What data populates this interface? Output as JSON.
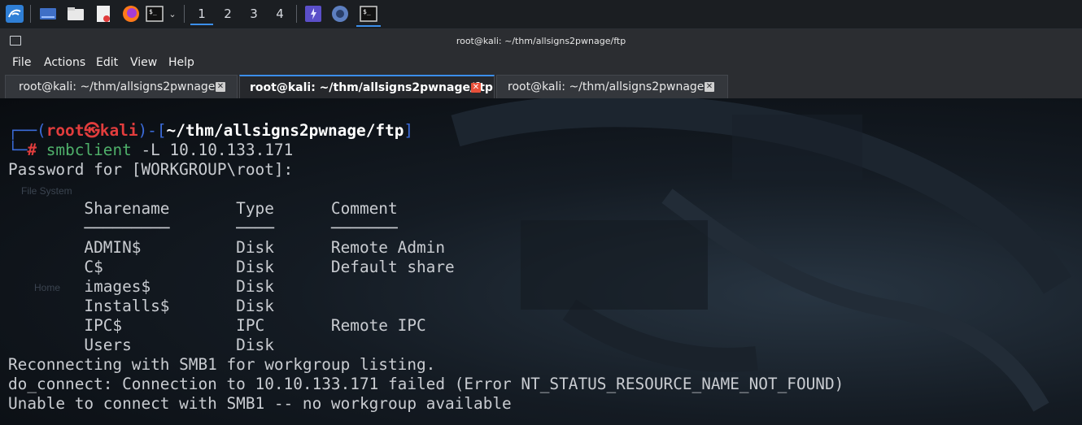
{
  "taskbar": {
    "workspaces": [
      "1",
      "2",
      "3",
      "4"
    ],
    "active_workspace": "1"
  },
  "window": {
    "title": "root@kali: ~/thm/allsigns2pwnage/ftp",
    "menu": [
      "File",
      "Actions",
      "Edit",
      "View",
      "Help"
    ],
    "tabs": [
      {
        "label": "root@kali: ~/thm/allsigns2pwnage",
        "active": false
      },
      {
        "label": "root@kali: ~/thm/allsigns2pwnage/ftp",
        "active": true
      },
      {
        "label": "root@kali: ~/thm/allsigns2pwnage",
        "active": false
      }
    ],
    "close_glyph": "✕"
  },
  "terminal": {
    "prompt": {
      "corner_top": "┌──(",
      "user": "root",
      "at": "㉿",
      "host": "kali",
      "mid": ")-[",
      "path": "~/thm/allsigns2pwnage/ftp",
      "end": "]",
      "corner_bottom": "└─",
      "hash": "#",
      "command": "smbclient",
      "args": " -L 10.10.133.171"
    },
    "lines": [
      "Password for [WORKGROUP\\root]:",
      "",
      "        Sharename       Type      Comment",
      "        ─────────       ────      ───────",
      "        ADMIN$          Disk      Remote Admin",
      "        C$              Disk      Default share",
      "        images$         Disk",
      "        Installs$       Disk",
      "        IPC$            IPC       Remote IPC",
      "        Users           Disk",
      "Reconnecting with SMB1 for workgroup listing.",
      "do_connect: Connection to 10.10.133.171 failed (Error NT_STATUS_RESOURCE_NAME_NOT_FOUND)",
      "Unable to connect with SMB1 -- no workgroup available"
    ],
    "background_text": [
      "File System",
      "Home"
    ]
  },
  "colors": {
    "accent": "#3b8eea",
    "prompt_blue": "#3b6bd9",
    "prompt_red": "#e23d3d",
    "command_green": "#4fb06a"
  }
}
